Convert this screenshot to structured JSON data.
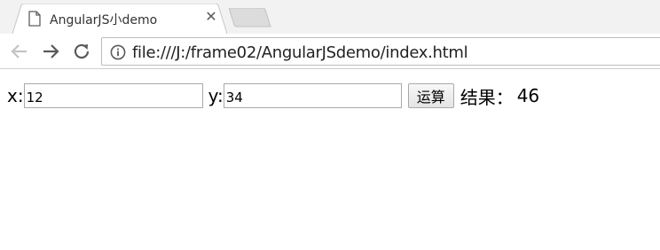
{
  "browser": {
    "tab": {
      "title": "AngularJS小demo",
      "close_glyph": "✕"
    },
    "address_bar": {
      "url": "file:///J:/frame02/AngularJSdemo/index.html"
    },
    "icons": {
      "page": "page-icon",
      "back": "back-arrow-icon",
      "forward": "forward-arrow-icon",
      "reload": "reload-icon",
      "info": "info-icon"
    }
  },
  "page": {
    "x": {
      "label": "x:",
      "value": "12"
    },
    "y": {
      "label": "y:",
      "value": "34"
    },
    "calc_button": {
      "label": "运算"
    },
    "result": {
      "label": "结果：",
      "value": "46"
    }
  }
}
